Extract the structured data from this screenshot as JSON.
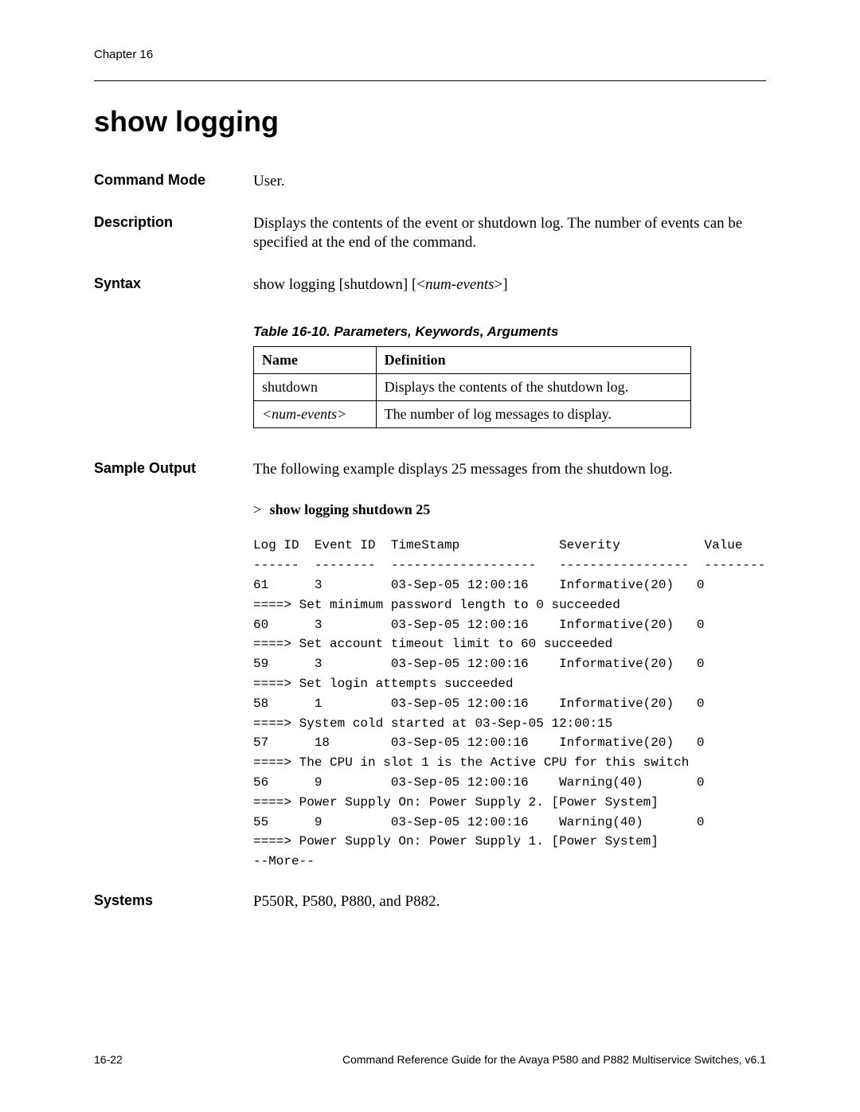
{
  "header": {
    "chapter": "Chapter 16"
  },
  "title": "show logging",
  "sections": {
    "command_mode": {
      "label": "Command Mode",
      "value": "User."
    },
    "description": {
      "label": "Description",
      "value": "Displays the contents of the event or shutdown log. The number of events can be specified at the end of the command."
    },
    "syntax": {
      "label": "Syntax",
      "prefix": "show logging [shutdown] [<",
      "arg": "num-events",
      "suffix": ">]"
    },
    "sample_output": {
      "label": "Sample Output",
      "intro": "The following example displays 25 messages from the shutdown log.",
      "prompt": ">",
      "command": "show logging shutdown 25",
      "lines": [
        "Log ID  Event ID  TimeStamp             Severity           Value",
        "------  --------  -------------------   -----------------  --------",
        "61      3         03-Sep-05 12:00:16    Informative(20)   0",
        "====> Set minimum password length to 0 succeeded",
        "60      3         03-Sep-05 12:00:16    Informative(20)   0",
        "====> Set account timeout limit to 60 succeeded",
        "59      3         03-Sep-05 12:00:16    Informative(20)   0",
        "====> Set login attempts succeeded",
        "58      1         03-Sep-05 12:00:16    Informative(20)   0",
        "====> System cold started at 03-Sep-05 12:00:15",
        "57      18        03-Sep-05 12:00:16    Informative(20)   0",
        "====> The CPU in slot 1 is the Active CPU for this switch",
        "56      9         03-Sep-05 12:00:16    Warning(40)       0",
        "====> Power Supply On: Power Supply 2. [Power System]",
        "55      9         03-Sep-05 12:00:16    Warning(40)       0",
        "====> Power Supply On: Power Supply 1. [Power System]",
        "--More--"
      ]
    },
    "systems": {
      "label": "Systems",
      "value": "P550R, P580, P880, and P882."
    }
  },
  "table": {
    "caption": "Table 16-10.  Parameters, Keywords, Arguments",
    "headers": [
      "Name",
      "Definition"
    ],
    "rows": [
      {
        "name": "shutdown",
        "definition": "Displays the contents of the shutdown log.",
        "italic": false
      },
      {
        "name": "<num-events>",
        "definition": "The number of log messages to display.",
        "italic": true
      }
    ]
  },
  "footer": {
    "left": "16-22",
    "right": "Command Reference Guide for the Avaya P580 and P882 Multiservice Switches, v6.1"
  }
}
